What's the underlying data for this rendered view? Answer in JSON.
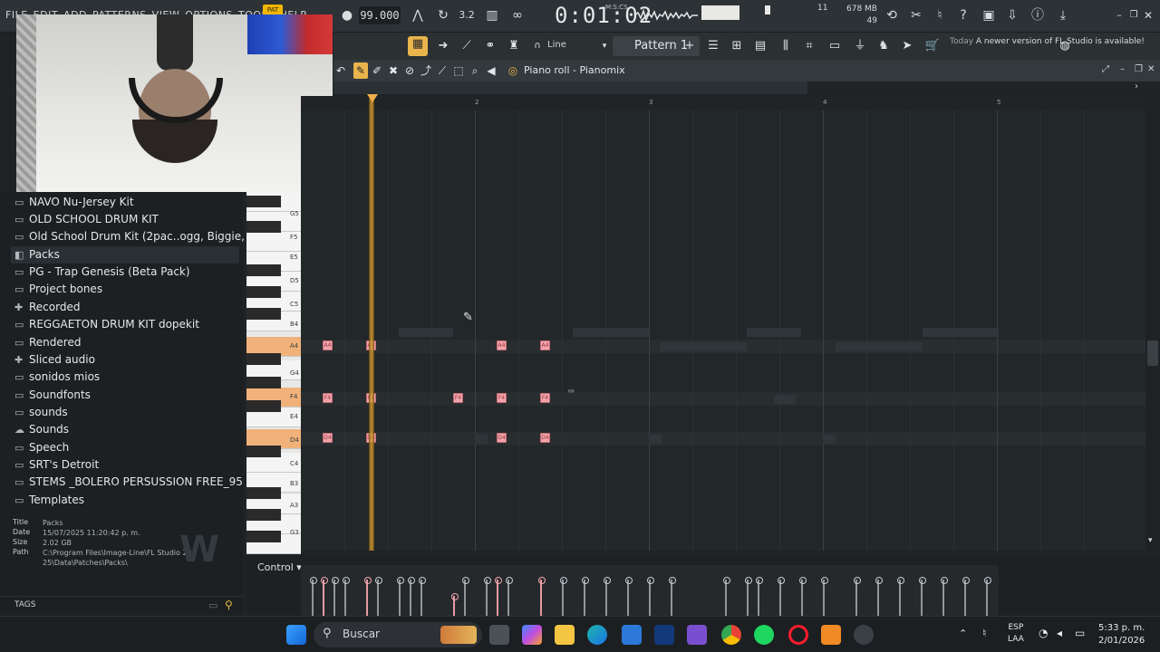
{
  "topbar": {
    "menus": [
      "FILE",
      "EDIT",
      "ADD",
      "PATTERNS",
      "VIEW",
      "OPTIONS",
      "TOOLS",
      "HELP"
    ],
    "pat_badge": "PAT",
    "tempo": "99.000",
    "time": "0:01:02",
    "time_unit": "M:S:CS",
    "memory": "678 MB",
    "cpu_value": "11",
    "poly_value": "49"
  },
  "toolbar2": {
    "line_label": "Line",
    "pattern_label": "Pattern 1",
    "news_date": "Today",
    "news_text": "A newer version of FL Studio is available!"
  },
  "browser": {
    "items": [
      {
        "label": "NAVO Nu-Jersey Kit",
        "icon": "folder-icon"
      },
      {
        "label": "OLD SCHOOL DRUM KIT",
        "icon": "folder-icon"
      },
      {
        "label": "Old School Drum Kit (2pac..ogg, Biggie, Nas, J Cole)",
        "icon": "folder-icon"
      },
      {
        "label": "Packs",
        "icon": "packs-icon"
      },
      {
        "label": "PG - Trap Genesis (Beta Pack)",
        "icon": "folder-icon"
      },
      {
        "label": "Project bones",
        "icon": "folder-icon"
      },
      {
        "label": "Recorded",
        "icon": "recorded-icon"
      },
      {
        "label": "REGGAETON DRUM KIT dopekit",
        "icon": "folder-icon"
      },
      {
        "label": "Rendered",
        "icon": "folder-icon"
      },
      {
        "label": "Sliced audio",
        "icon": "sliced-icon"
      },
      {
        "label": "sonidos mios",
        "icon": "folder-icon"
      },
      {
        "label": "Soundfonts",
        "icon": "folder-icon"
      },
      {
        "label": "sounds",
        "icon": "folder-icon"
      },
      {
        "label": "Sounds",
        "icon": "cloud-icon"
      },
      {
        "label": "Speech",
        "icon": "folder-icon"
      },
      {
        "label": "SRT's Detroit",
        "icon": "folder-icon"
      },
      {
        "label": "STEMS _BOLERO PERSUSSION FREE_95 BPM",
        "icon": "folder-icon"
      },
      {
        "label": "Templates",
        "icon": "folder-icon"
      }
    ],
    "selected_index": 3
  },
  "info": {
    "title_key": "Title",
    "title_val": "Packs",
    "date_key": "Date",
    "date_val": "15/07/2025 11:20:42 p. m.",
    "size_key": "Size",
    "size_val": "2.02 GB",
    "path_key": "Path",
    "path_val": "C:\\Program Files\\Image-Line\\FL Studio 2025\\Data\\Patches\\Packs\\"
  },
  "tags_label": "TAGS",
  "piano_roll": {
    "title": "Piano roll - Pianomix",
    "ruler": [
      "2",
      "3",
      "4",
      "5"
    ],
    "keys": [
      "G5",
      "F5",
      "E5",
      "D5",
      "C5",
      "B4",
      "A4",
      "G4",
      "F4",
      "E4",
      "D4",
      "C4",
      "B3",
      "A3",
      "G3"
    ],
    "highlighted_keys": [
      "A4",
      "F4",
      "D4"
    ],
    "note_labels": {
      "a4": "A4",
      "f4": "F4",
      "d4": "D4"
    },
    "control_label": "Control"
  },
  "taskbar": {
    "search_placeholder": "Buscar",
    "lang_top": "ESP",
    "lang_bottom": "LAA",
    "time": "5:33 p. m.",
    "date": "2/01/2026"
  }
}
